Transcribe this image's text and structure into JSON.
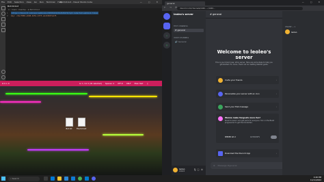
{
  "vscode": {
    "menu": [
      "File",
      "Edit",
      "Selection",
      "View",
      "Go",
      "Run",
      "Terminal",
      "Help"
    ],
    "window_title": "Bot.txt.bot - Visual Studio Code",
    "window_controls": "— ▢ ✕",
    "tab": "Bot.txt.bot",
    "breadcrumb": "C: › Users › Desktop › ☰ Bot.txt.bot",
    "lines": [
      {
        "num": "1",
        "text": "https://discord.com/api/webhooks/987654321012345678/XyZ-redacted-webhook-token"
      },
      {
        "num": "2",
        "text": "key: c3ec7869-a9d8-4251-b7f3-a1c43b57e175"
      }
    ],
    "status_left": "⊗ 0 ⚠ 0",
    "status_right": [
      "Ln 1, Col 1 (91 selected)",
      "Spaces: 4",
      "UTF-8",
      "CRLF",
      "Plain Text",
      "♫"
    ]
  },
  "desktop": {
    "files": [
      "Bot.txt",
      "File.txt.bot"
    ]
  },
  "taskbar": {
    "search": "Search",
    "time": "4:46 PM",
    "date": "11/11/2022"
  },
  "chrome": {
    "tab_title": "general",
    "url": "discord.com/channels/1040...../1040...",
    "nav": "← → ⟳",
    "window_controls": "— ▢ ✕"
  },
  "discord": {
    "server_name": "leoleo's server",
    "categories": [
      "TEXT CHANNELS",
      "VOICE CHANNELS"
    ],
    "channels": [
      "# general",
      "🔊 General"
    ],
    "channel_header": "# general",
    "welcome_title": "Welcome to leoleo's server",
    "welcome_sub": "This is your brand new, shiny server. Here are some steps to help you get started. For more, check out our Getting Started guide.",
    "cards": [
      {
        "label": "Invite your friends",
        "color": "#f0b232"
      },
      {
        "label": "Personalize your server with an icon",
        "color": "#5865f2"
      },
      {
        "label": "Send your first message",
        "color": "#3ba55d"
      },
      {
        "label": "Download the Discord App",
        "color": "#5865f2"
      }
    ],
    "boost_title": "Wanna make fanguats more fun?",
    "boost_text": "Boost to Level 1 and get perks for everyone. Turn on the Boost progress bar to get friends started.",
    "boost_level": "SERVER LVL 0",
    "boost_progress": "0/2 BOOSTS",
    "message_placeholder": "Message #general",
    "online_header": "ONLINE — 1",
    "member_name": "leoleo",
    "user_name": "leoleo",
    "user_tag": "#0828"
  },
  "colors": {
    "vscode_status": "#cc1e5c",
    "discord_blurple": "#5865f2"
  }
}
